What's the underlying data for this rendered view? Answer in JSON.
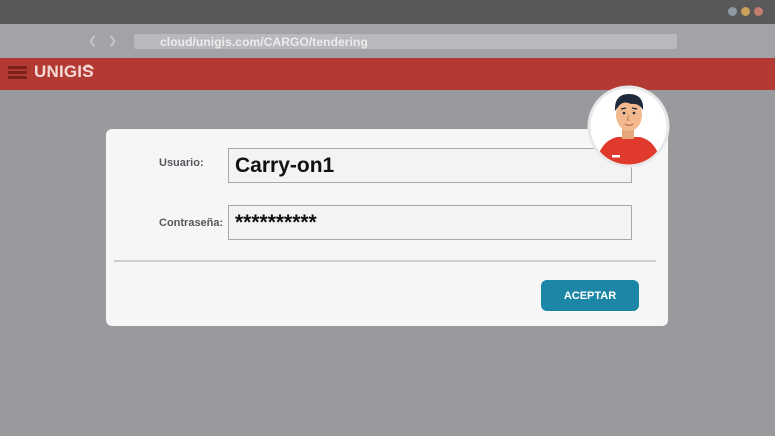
{
  "browser": {
    "url": "cloud/unigis.com/CARGO/tendering",
    "back_icon": "chevron-left-icon",
    "forward_icon": "chevron-right-icon",
    "window_dots": [
      "#8e9aa3",
      "#c9a15a",
      "#c27b6c"
    ]
  },
  "app": {
    "logo": "UNIGIS",
    "brand_color": "#b33a32",
    "menu_icon": "hamburger-menu-icon"
  },
  "login": {
    "user_label": "Usuario:",
    "user_value": "Carry-on1",
    "password_label": "Contraseña:",
    "password_value": "**********",
    "submit_label": "ACEPTAR",
    "button_color": "#1c86a6"
  },
  "avatar": {
    "icon": "user-avatar-icon"
  }
}
